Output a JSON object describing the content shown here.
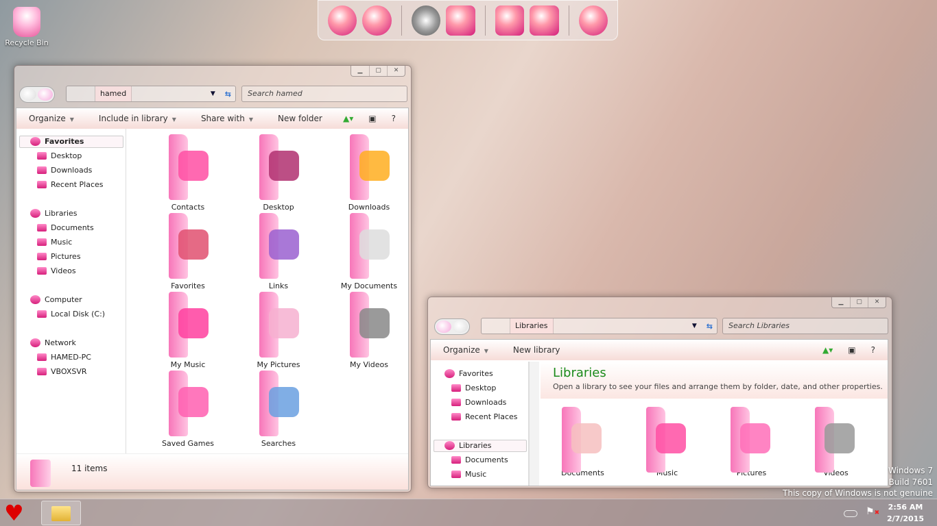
{
  "desktop": {
    "recycle_bin": "Recycle Bin"
  },
  "dock": {
    "icons": [
      "internet-icon",
      "globe-icon",
      "settings-icon",
      "games-icon",
      "drive-icon",
      "printer-icon",
      "recycle-icon"
    ]
  },
  "explorer1": {
    "address_crumb": "hamed",
    "search_placeholder": "Search hamed",
    "toolbar": {
      "organize": "Organize",
      "include": "Include in library",
      "share": "Share with",
      "new_folder": "New folder",
      "help": "?"
    },
    "nav": {
      "favorites": "Favorites",
      "desktop": "Desktop",
      "downloads": "Downloads",
      "recent": "Recent Places",
      "libraries": "Libraries",
      "documents": "Documents",
      "music": "Music",
      "pictures": "Pictures",
      "videos": "Videos",
      "computer": "Computer",
      "local_disk": "Local Disk (C:)",
      "network": "Network",
      "pc1": "HAMED-PC",
      "pc2": "VBOXSVR"
    },
    "items": [
      "Contacts",
      "Desktop",
      "Downloads",
      "Favorites",
      "Links",
      "My Documents",
      "My Music",
      "My Pictures",
      "My Videos",
      "Saved Games",
      "Searches"
    ],
    "status": "11 items"
  },
  "explorer2": {
    "address_crumb": "Libraries",
    "search_placeholder": "Search Libraries",
    "toolbar": {
      "organize": "Organize",
      "new_library": "New library",
      "help": "?"
    },
    "nav": {
      "favorites": "Favorites",
      "desktop": "Desktop",
      "downloads": "Downloads",
      "recent": "Recent Places",
      "libraries": "Libraries",
      "documents": "Documents",
      "music": "Music"
    },
    "heading": "Libraries",
    "heading_color": "#1a8a1a",
    "description": "Open a library to see your files and arrange them by folder, date, and other properties.",
    "items": [
      "Documents",
      "Music",
      "Pictures",
      "Videos"
    ]
  },
  "watermark": {
    "line1": "Windows 7",
    "line2": "Build 7601",
    "line3": "This copy of Windows is not genuine"
  },
  "tray": {
    "time": "2:56 AM",
    "date": "2/7/2015"
  }
}
